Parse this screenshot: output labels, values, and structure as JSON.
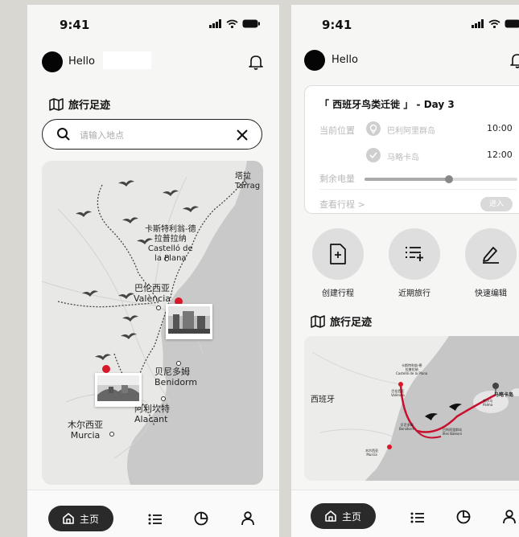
{
  "status": {
    "time": "9:41"
  },
  "left": {
    "greeting": "Hello",
    "section_title": "旅行足迹",
    "search": {
      "placeholder": "请输入地点",
      "value": ""
    },
    "map": {
      "labels": {
        "tarragona": "塔拉\nTarrag",
        "castellon": "卡斯特利翁-德\n拉普拉纳\nCastelló de\nla Plana",
        "valencia": "巴伦西亚\nValència",
        "benidorm": "贝尼多姆\nBenidorm",
        "alacant": "阿利坎特\nAlacant",
        "murcia": "木尔西亚\nMurcia"
      }
    },
    "tabbar": {
      "home_label": "主页"
    }
  },
  "right": {
    "greeting": "Hello",
    "trip": {
      "title": "「 西班牙鸟类迁徙 」 - Day 3",
      "current_label": "当前位置",
      "stops": [
        {
          "name": "巴利阿里群岛",
          "time": "10:00"
        },
        {
          "name": "马略卡岛",
          "time": "12:00"
        }
      ],
      "battery_label": "剩余电量",
      "battery_level": 0.55,
      "view_label": "查看行程 >",
      "enter_label": "进入"
    },
    "actions": [
      {
        "label": "创建行程",
        "icon": "file-plus-icon"
      },
      {
        "label": "近期旅行",
        "icon": "list-plus-icon"
      },
      {
        "label": "快速编辑",
        "icon": "pencil-icon"
      }
    ],
    "section_title": "旅行足迹",
    "map": {
      "country": "西班牙",
      "destination": "马略卡岛",
      "small_labels": {
        "castellon": "卡斯特利翁-德\n拉普拉纳\nCastelló de la Plana",
        "valencia": "巴伦西亚\nValència",
        "benidorm": "贝尼多姆\nBenidorm",
        "murcia": "木尔西亚\nMurcia",
        "palma": "帕尔马\nPalma",
        "balearic": "巴利阿里群岛\nIlles Balears"
      }
    },
    "tabbar": {
      "home_label": "主页"
    }
  },
  "colors": {
    "accent_route": "#c8102e",
    "pin": "#d7192a",
    "dark": "#2a2a2a"
  }
}
